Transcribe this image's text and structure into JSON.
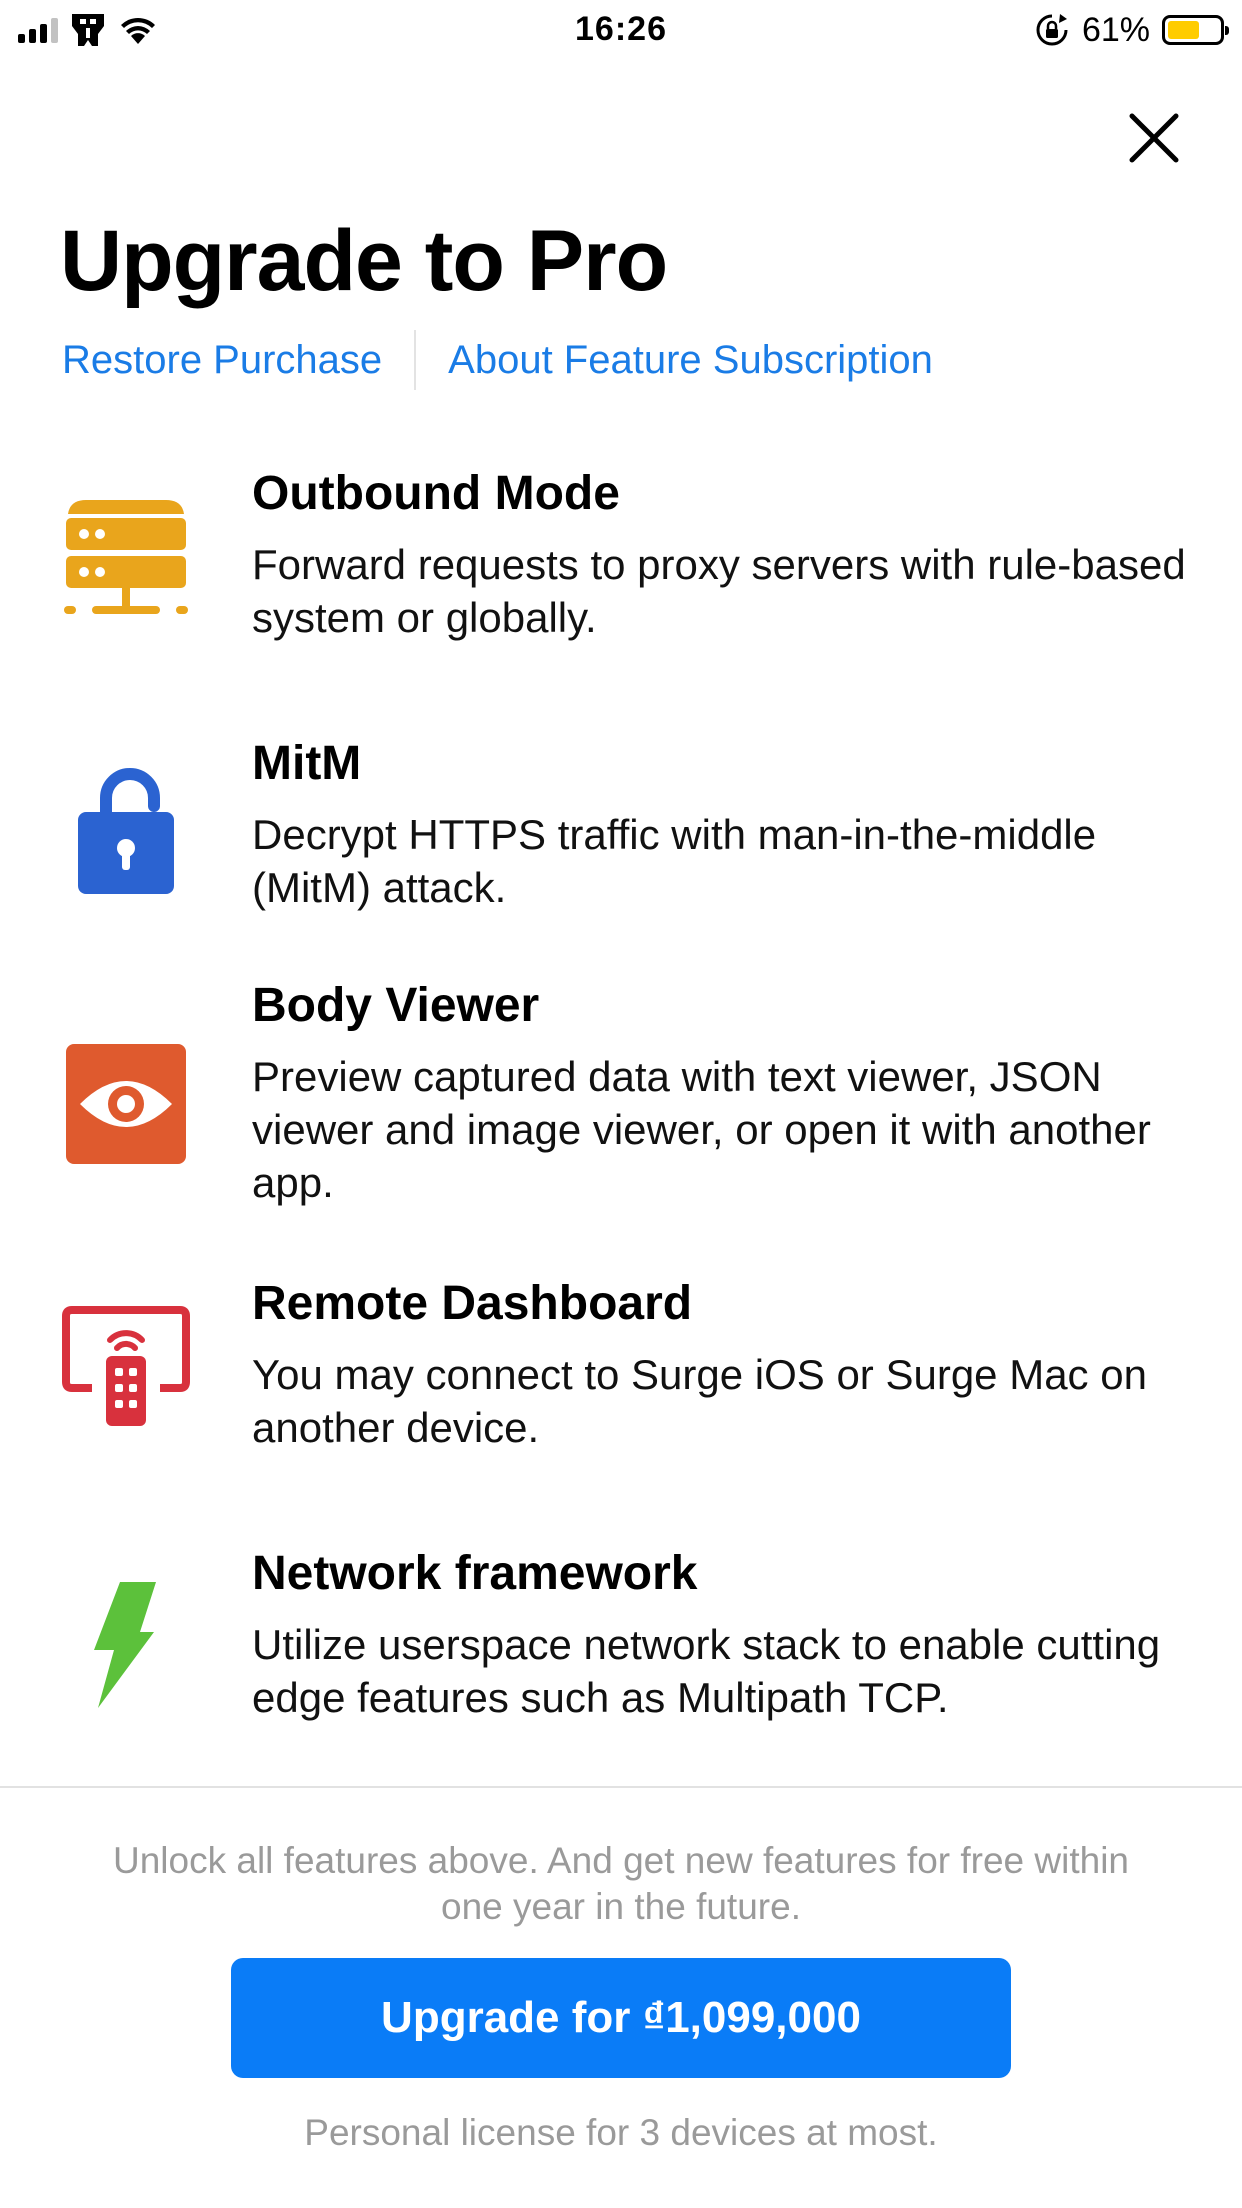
{
  "status_bar": {
    "time": "16:26",
    "battery_percent": "61%",
    "battery_level": 0.61,
    "signal_bars": 3,
    "signal_bars_total": 4
  },
  "header": {
    "title": "Upgrade to Pro",
    "restore_label": "Restore Purchase",
    "about_label": "About Feature Subscription",
    "close_icon": "close-icon"
  },
  "features": [
    {
      "icon": "server-icon",
      "icon_color": "#e9a51c",
      "title": "Outbound Mode",
      "desc": "Forward requests to proxy servers with rule-based system or globally."
    },
    {
      "icon": "lock-icon",
      "icon_color": "#2b63d1",
      "title": "MitM",
      "desc": "Decrypt HTTPS traffic with man-in-the-middle (MitM) attack."
    },
    {
      "icon": "eye-icon",
      "icon_color": "#df5a2e",
      "title": "Body Viewer",
      "desc": "Preview captured data with text viewer, JSON viewer and image viewer, or open it with another app."
    },
    {
      "icon": "remote-dashboard-icon",
      "icon_color": "#d8313d",
      "title": "Remote Dashboard",
      "desc": "You may connect to Surge iOS or Surge Mac on another device."
    },
    {
      "icon": "lightning-bolt-icon",
      "icon_color": "#5cc13b",
      "title": "Network framework",
      "desc": "Utilize userspace network stack to enable cutting edge features such as Multipath TCP."
    }
  ],
  "footer": {
    "unlock_text": "Unlock all features above. And get new features for free within one year in the future.",
    "upgrade_label": "Upgrade for ₫1,099,000",
    "license_text": "Personal license for 3 devices at most."
  },
  "colors": {
    "link": "#1a7ce6",
    "button": "#0a7cf7",
    "battery_fill": "#ffcc00"
  }
}
